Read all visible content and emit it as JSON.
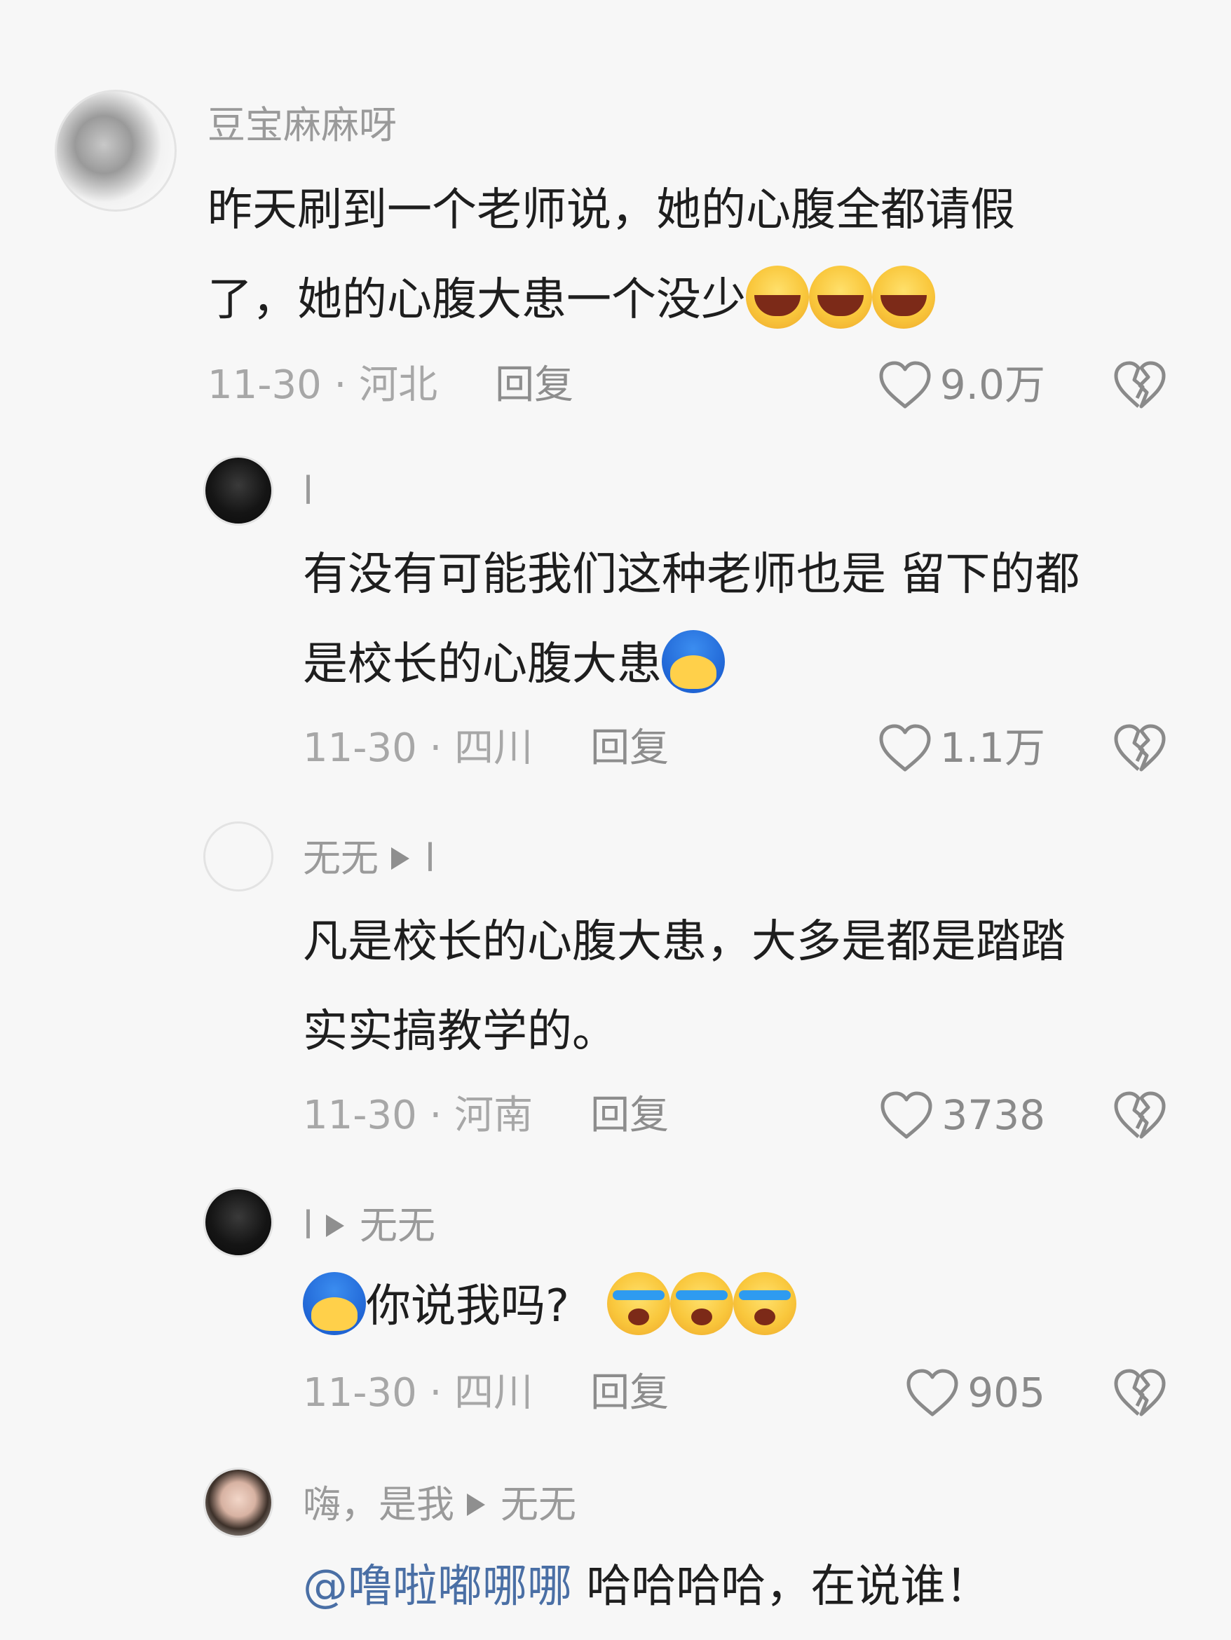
{
  "comments": [
    {
      "author": "豆宝麻麻呀",
      "text_line1": "昨天刷到一个老师说，她的心腹全都请假",
      "text_line2": "了，她的心腹大患一个没少",
      "date_loc": "11-30 · 河北",
      "reply": "回复",
      "likes": "9.0万"
    },
    {
      "author": "l",
      "text_line1": "有没有可能我们这种老师也是 留下的都",
      "text_line2": "是校长的心腹大患",
      "date_loc": "11-30 · 四川",
      "reply": "回复",
      "likes": "1.1万"
    },
    {
      "author": "无无",
      "reply_to": "l",
      "text_line1": "凡是校长的心腹大患，大多是都是踏踏",
      "text_line2": "实实搞教学的。",
      "date_loc": "11-30 · 河南",
      "reply": "回复",
      "likes": "3738"
    },
    {
      "author": "l",
      "reply_to": "无无",
      "text": "你说我吗?",
      "date_loc": "11-30 · 四川",
      "reply": "回复",
      "likes": "905"
    },
    {
      "author": "嗨，是我",
      "reply_to": "无无",
      "mention": "@噜啦嘟哪哪",
      "text": "哈哈哈哈，在说谁！"
    }
  ],
  "emoji_names": [
    "laugh-emoji",
    "cry-laugh-emoji",
    "blue-hair-emoji"
  ],
  "colors": {
    "background": "#f7f7f7",
    "mention": "#4a6fa5",
    "meta_text": "#a7a7a7"
  }
}
